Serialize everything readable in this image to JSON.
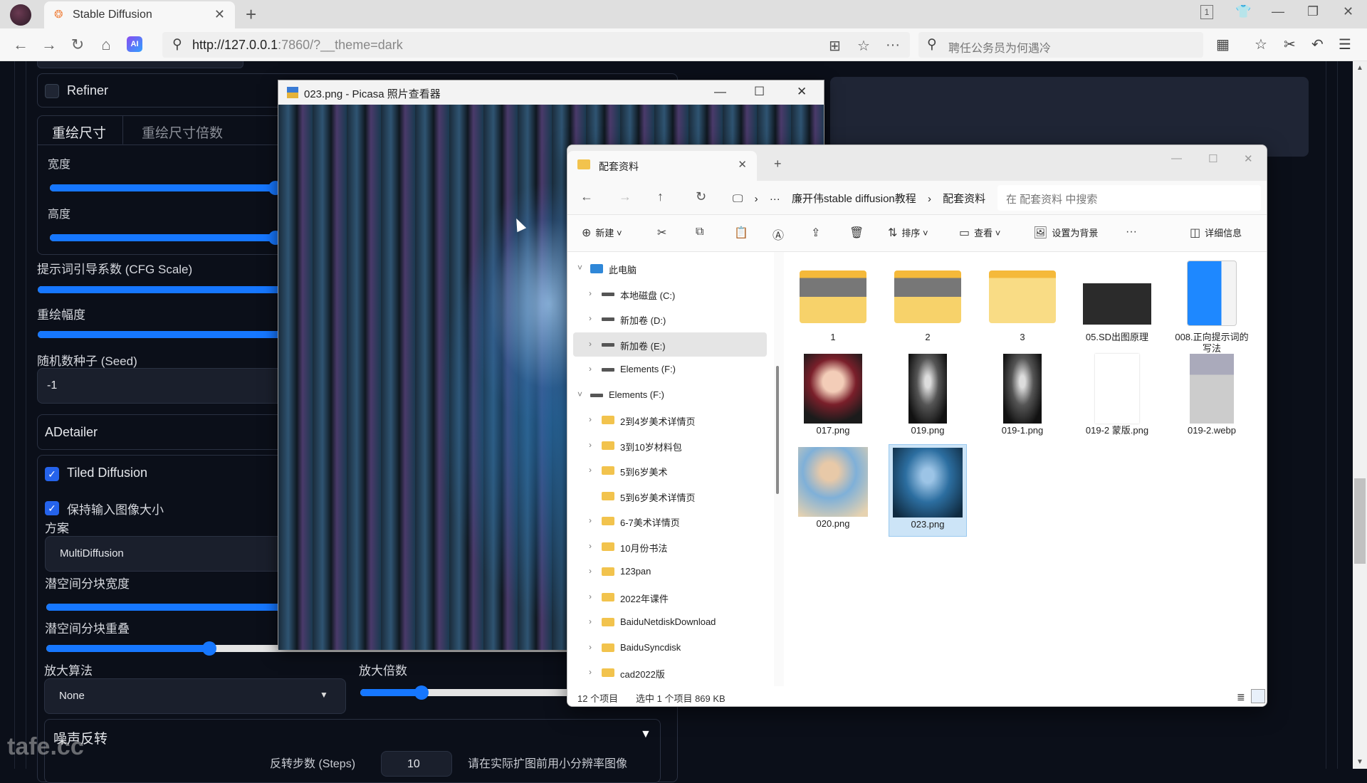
{
  "browser": {
    "tab_title": "Stable Diffusion",
    "url_host": "http://127.0.0.1",
    "url_rest": ":7860/?__theme=dark",
    "side_search_placeholder": "聘任公务员为何遇冷",
    "tab_count_badge": "1"
  },
  "sd": {
    "refiner_label": "Refiner",
    "refiner_checked": false,
    "resize_tabs": [
      "重绘尺寸",
      "重绘尺寸倍数"
    ],
    "width_label": "宽度",
    "width_slider": 0.36,
    "height_label": "高度",
    "height_slider": 0.36,
    "cfg_label": "提示词引导系数 (CFG Scale)",
    "cfg_slider": 0.57,
    "denoise_label": "重绘幅度",
    "denoise_slider": 1.0,
    "seed_label": "随机数种子 (Seed)",
    "seed_value": "-1",
    "adetailer_label": "ADetailer",
    "tiled_label": "Tiled Diffusion",
    "tiled_checked": true,
    "keep_size_label": "保持输入图像大小",
    "keep_size_checked": true,
    "method_label": "方案",
    "method_value": "MultiDiffusion",
    "tile_width_label": "潜空间分块宽度",
    "tile_width_slider": 0.45,
    "tile_overlap_label": "潜空间分块重叠",
    "tile_overlap_slider": 0.26,
    "upscaler_label": "放大算法",
    "upscaler_value": "None",
    "scale_label": "放大倍数",
    "scale_slider": 0.2,
    "noise_inversion_label": "噪声反转",
    "inversion_steps_label": "反转步数 (Steps)",
    "inversion_steps_value": "10",
    "inversion_hint": "请在实际扩图前用小分辨率图像"
  },
  "picasa": {
    "title": "023.png - Picasa 照片查看器"
  },
  "explorer": {
    "tab_label": "配套资料",
    "breadcrumb": [
      "廉开伟stable diffusion教程",
      "配套资料"
    ],
    "search_placeholder": "在 配套资料 中搜索",
    "commands": {
      "new": "新建",
      "sort": "排序",
      "view": "查看",
      "set_background": "设置为背景",
      "details": "详细信息"
    },
    "tree": [
      {
        "label": "此电脑",
        "icon": "pc",
        "level": 0,
        "expanded": true
      },
      {
        "label": "本地磁盘 (C:)",
        "icon": "drive",
        "level": 1
      },
      {
        "label": "新加卷 (D:)",
        "icon": "drive",
        "level": 1
      },
      {
        "label": "新加卷 (E:)",
        "icon": "drive",
        "level": 1,
        "selected": true
      },
      {
        "label": "Elements (F:)",
        "icon": "drive",
        "level": 1
      },
      {
        "label": "Elements (F:)",
        "icon": "drive",
        "level": 0,
        "expanded": true
      },
      {
        "label": "2到4岁美术详情页",
        "icon": "folder",
        "level": 1
      },
      {
        "label": "3到10岁材料包",
        "icon": "folder",
        "level": 1
      },
      {
        "label": "5到6岁美术",
        "icon": "folder",
        "level": 1
      },
      {
        "label": "5到6岁美术详情页",
        "icon": "folder",
        "level": 1,
        "no_chevron": true
      },
      {
        "label": "6-7美术详情页",
        "icon": "folder",
        "level": 1
      },
      {
        "label": "10月份书法",
        "icon": "folder",
        "level": 1
      },
      {
        "label": "123pan",
        "icon": "folder",
        "level": 1
      },
      {
        "label": "2022年课件",
        "icon": "folder",
        "level": 1
      },
      {
        "label": "BaiduNetdiskDownload",
        "icon": "folder",
        "level": 1
      },
      {
        "label": "BaiduSyncdisk",
        "icon": "folder",
        "level": 1
      },
      {
        "label": "cad2022版",
        "icon": "folder",
        "level": 1
      }
    ],
    "files": [
      {
        "name": "1",
        "kind": "folder-preview"
      },
      {
        "name": "2",
        "kind": "folder-preview"
      },
      {
        "name": "3",
        "kind": "folder"
      },
      {
        "name": "05.SD出图原理",
        "kind": "dark-image"
      },
      {
        "name": "008.正向提示词的写法",
        "kind": "wps-doc"
      },
      {
        "name": "017.png",
        "kind": "photo-portrait"
      },
      {
        "name": "019.png",
        "kind": "photo-mecha"
      },
      {
        "name": "019-1.png",
        "kind": "photo-mecha"
      },
      {
        "name": "019-2 蒙版.png",
        "kind": "blank"
      },
      {
        "name": "019-2.webp",
        "kind": "photo-street"
      },
      {
        "name": "020.png",
        "kind": "photo-beach"
      },
      {
        "name": "023.png",
        "kind": "photo-blue",
        "selected": true
      }
    ],
    "status_count": "12 个项目",
    "status_selected": "选中 1 个项目  869 KB"
  },
  "watermark": "tafe.cc"
}
